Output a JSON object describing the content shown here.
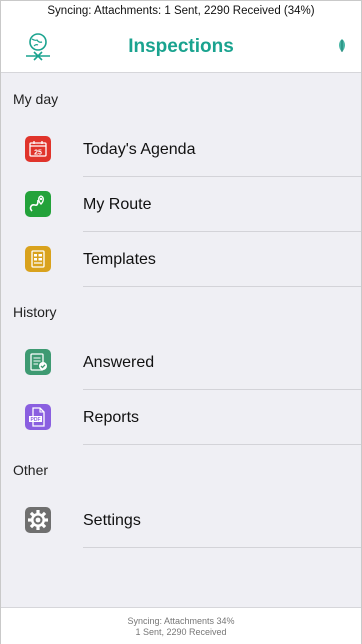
{
  "status_bar": {
    "text": "Syncing: Attachments: 1 Sent, 2290 Received (34%)"
  },
  "navbar": {
    "title": "Inspections",
    "left_icon": "sync-globe-icon",
    "right_icon": "leaf-icon"
  },
  "sections": [
    {
      "header": "My day",
      "items": [
        {
          "label": "Today's Agenda",
          "icon": "calendar-icon",
          "color": "#e0342b",
          "badge": "25"
        },
        {
          "label": "My Route",
          "icon": "route-icon",
          "color": "#23a23a"
        },
        {
          "label": "Templates",
          "icon": "templates-icon",
          "color": "#d9a21d"
        }
      ]
    },
    {
      "header": "History",
      "items": [
        {
          "label": "Answered",
          "icon": "answered-icon",
          "color": "#3e9a72"
        },
        {
          "label": "Reports",
          "icon": "pdf-icon",
          "color": "#8a5fe0",
          "badge": "PDF"
        }
      ]
    },
    {
      "header": "Other",
      "items": [
        {
          "label": "Settings",
          "icon": "gear-icon",
          "color": "#6f6f6f"
        }
      ]
    }
  ],
  "footer": {
    "line1": "Syncing: Attachments 34%",
    "line2": "1 Sent, 2290 Received"
  },
  "colors": {
    "accent": "#1aa38f",
    "background": "#efeff4"
  }
}
